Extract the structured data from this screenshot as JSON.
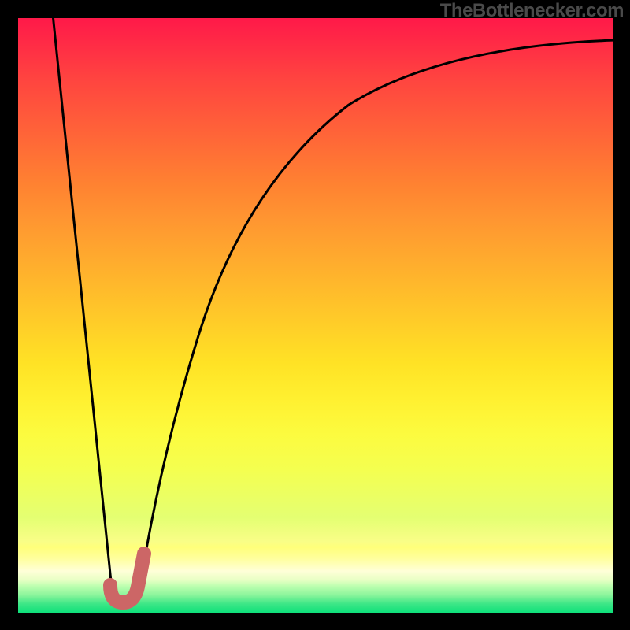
{
  "watermark": "TheBottlenecker.com",
  "chart_data": {
    "type": "line",
    "title": "",
    "xlabel": "",
    "ylabel": "",
    "xlim": [
      0,
      100
    ],
    "ylim": [
      0,
      100
    ],
    "grid": false,
    "legend": false,
    "background": {
      "kind": "vertical-gradient",
      "description": "Red (top) through orange, yellow, pale yellow, to green (bottom) representing bottleneck severity; green = low bottleneck, red = high bottleneck",
      "stops": [
        {
          "pos": 0.0,
          "color": "#ff1949"
        },
        {
          "pos": 0.3,
          "color": "#ff8231"
        },
        {
          "pos": 0.6,
          "color": "#ffe225"
        },
        {
          "pos": 0.88,
          "color": "#ffff7a"
        },
        {
          "pos": 1.0,
          "color": "#0ee07a"
        }
      ]
    },
    "series": [
      {
        "name": "bottleneck-curve",
        "description": "Bottleneck percentage vs. component match; sharp V with minimum near x≈15 then asymptotic rise",
        "x": [
          6,
          8,
          10,
          12,
          14,
          15.5,
          17,
          19,
          22,
          26,
          32,
          40,
          50,
          62,
          78,
          100
        ],
        "values": [
          100,
          76,
          52,
          28,
          8,
          2,
          4,
          12,
          28,
          44,
          60,
          74,
          84,
          90,
          94,
          96
        ]
      }
    ],
    "annotations": [
      {
        "name": "optimal-region-marker",
        "shape": "J",
        "color": "#cc6666",
        "x_range": [
          14,
          20
        ],
        "y_range": [
          0,
          6
        ],
        "description": "Thick J-shaped stroke highlighting the valley / optimal match point"
      }
    ]
  }
}
